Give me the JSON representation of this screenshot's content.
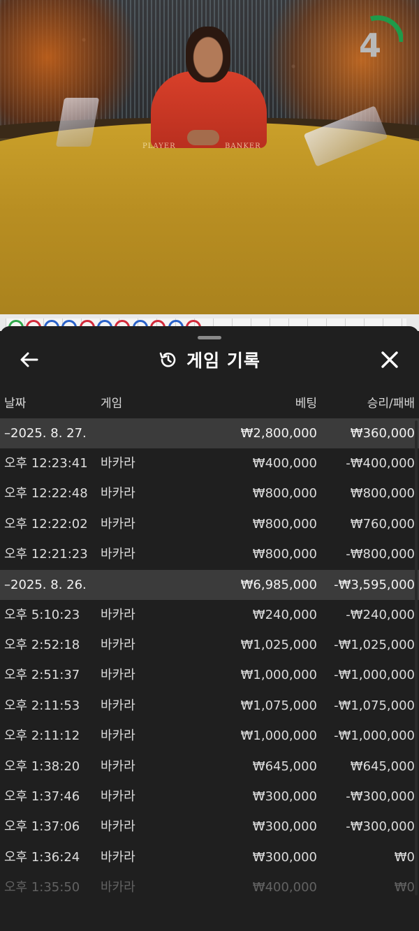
{
  "video": {
    "timer": "4",
    "felt_labels": {
      "player": "PLAYER",
      "banker": "BANKER"
    }
  },
  "roadmap": {
    "beads": [
      "green",
      "red",
      "blue",
      "blue",
      "red",
      "blue",
      "red",
      "blue",
      "red",
      "blue",
      "red"
    ],
    "colors": {
      "red": "#d22a3a",
      "blue": "#2a62c9",
      "green": "#2fa84a"
    }
  },
  "sheet": {
    "title": "게임 기록",
    "icons": {
      "back": "arrow-left-icon",
      "history": "history-icon",
      "close": "close-icon"
    },
    "columns": {
      "time": "날짜",
      "game": "게임",
      "bet": "베팅",
      "result": "승리/패배"
    },
    "groups": [
      {
        "date": "–2025. 8. 27.",
        "total_bet": "₩2,800,000",
        "total_result": "₩360,000",
        "rows": [
          {
            "time": "오후 12:23:41",
            "game": "바카라",
            "bet": "₩400,000",
            "result": "-₩400,000"
          },
          {
            "time": "오후 12:22:48",
            "game": "바카라",
            "bet": "₩800,000",
            "result": "₩800,000"
          },
          {
            "time": "오후 12:22:02",
            "game": "바카라",
            "bet": "₩800,000",
            "result": "₩760,000"
          },
          {
            "time": "오후 12:21:23",
            "game": "바카라",
            "bet": "₩800,000",
            "result": "-₩800,000"
          }
        ]
      },
      {
        "date": "–2025. 8. 26.",
        "total_bet": "₩6,985,000",
        "total_result": "-₩3,595,000",
        "rows": [
          {
            "time": "오후 5:10:23",
            "game": "바카라",
            "bet": "₩240,000",
            "result": "-₩240,000"
          },
          {
            "time": "오후 2:52:18",
            "game": "바카라",
            "bet": "₩1,025,000",
            "result": "-₩1,025,000"
          },
          {
            "time": "오후 2:51:37",
            "game": "바카라",
            "bet": "₩1,000,000",
            "result": "-₩1,000,000"
          },
          {
            "time": "오후 2:11:53",
            "game": "바카라",
            "bet": "₩1,075,000",
            "result": "-₩1,075,000"
          },
          {
            "time": "오후 2:11:12",
            "game": "바카라",
            "bet": "₩1,000,000",
            "result": "-₩1,000,000"
          },
          {
            "time": "오후 1:38:20",
            "game": "바카라",
            "bet": "₩645,000",
            "result": "₩645,000"
          },
          {
            "time": "오후 1:37:46",
            "game": "바카라",
            "bet": "₩300,000",
            "result": "-₩300,000"
          },
          {
            "time": "오후 1:37:06",
            "game": "바카라",
            "bet": "₩300,000",
            "result": "-₩300,000"
          },
          {
            "time": "오후 1:36:24",
            "game": "바카라",
            "bet": "₩300,000",
            "result": "₩0"
          },
          {
            "time": "오후 1:35:50",
            "game": "바카라",
            "bet": "₩400,000",
            "result": "₩0",
            "faded": true
          }
        ]
      }
    ]
  }
}
